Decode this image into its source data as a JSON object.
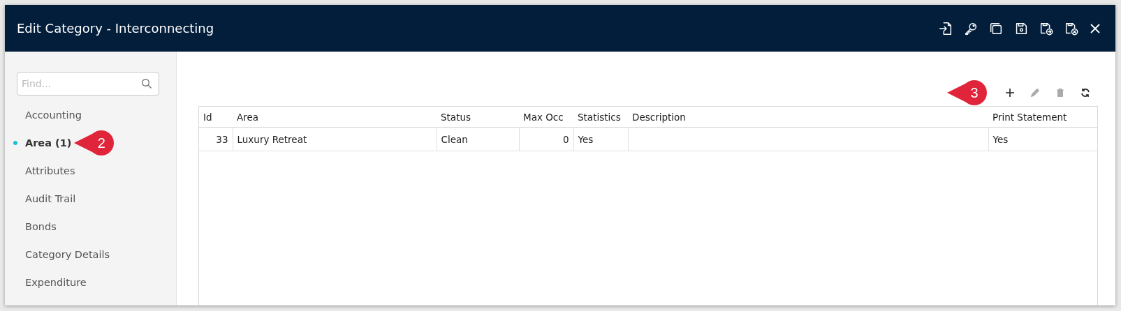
{
  "window": {
    "title": "Edit Category - Interconnecting"
  },
  "sidebar": {
    "search": {
      "placeholder": "Find..."
    },
    "items": [
      {
        "label": "Accounting",
        "selected": false
      },
      {
        "label": "Area (1)",
        "selected": true,
        "callout": "2"
      },
      {
        "label": "Attributes",
        "selected": false
      },
      {
        "label": "Audit Trail",
        "selected": false
      },
      {
        "label": "Bonds",
        "selected": false
      },
      {
        "label": "Category Details",
        "selected": false
      },
      {
        "label": "Expenditure",
        "selected": false
      }
    ]
  },
  "toolbar": {
    "callout": "3",
    "buttons": [
      {
        "kind": "add",
        "disabled": false
      },
      {
        "kind": "edit",
        "disabled": true
      },
      {
        "kind": "delete",
        "disabled": true
      },
      {
        "kind": "refresh",
        "disabled": false
      }
    ]
  },
  "table": {
    "columns": [
      {
        "label": "Id",
        "kind": "number"
      },
      {
        "label": "Area",
        "kind": "text"
      },
      {
        "label": "Status",
        "kind": "text"
      },
      {
        "label": "Max Occ",
        "kind": "number"
      },
      {
        "label": "Statistics",
        "kind": "text"
      },
      {
        "label": "Description",
        "kind": "text"
      },
      {
        "label": "Print Statement",
        "kind": "text"
      }
    ],
    "rows": [
      [
        "33",
        "Luxury Retreat",
        "Clean",
        "0",
        "Yes",
        "",
        "Yes"
      ]
    ]
  }
}
